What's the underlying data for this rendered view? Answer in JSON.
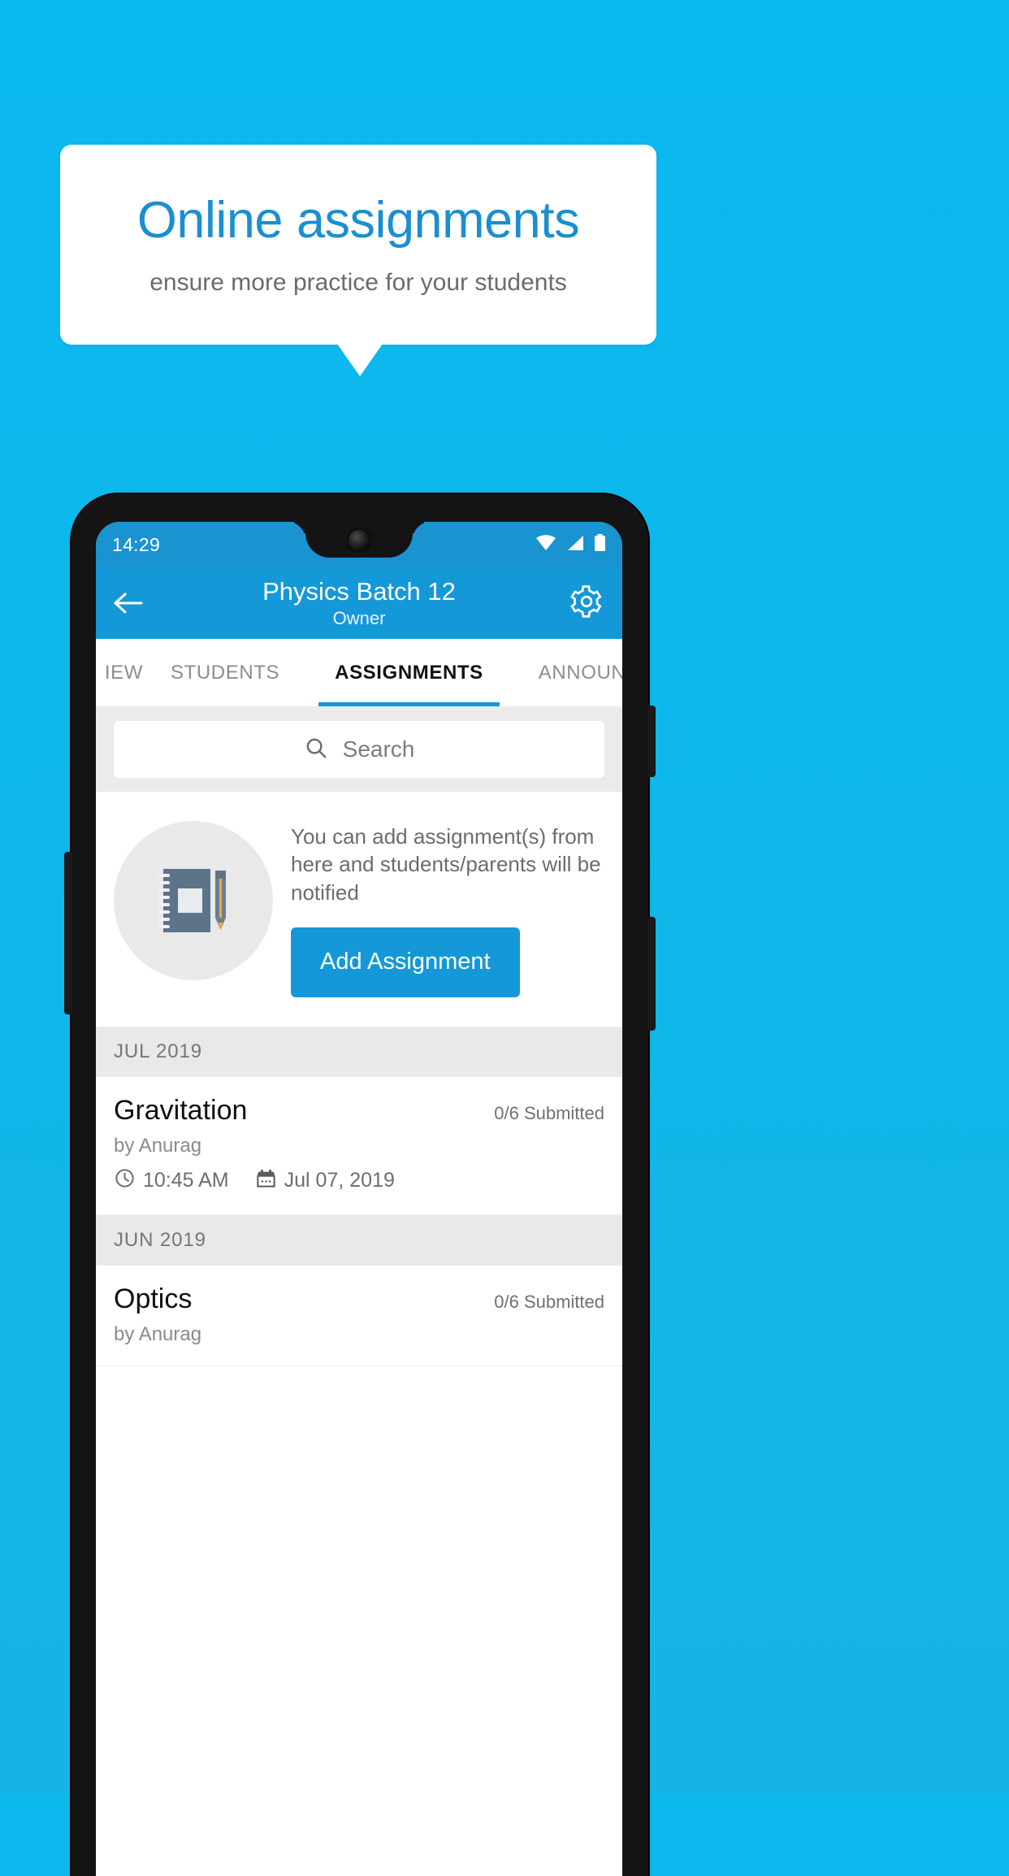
{
  "promo": {
    "background_color": "#0ab9ef",
    "callout": {
      "title": "Online assignments",
      "title_color": "#1a8fd0",
      "subtitle": "ensure more practice for your students",
      "subtitle_color": "#6b6b6b"
    }
  },
  "phone": {
    "status_bar": {
      "time": "14:29",
      "icons": [
        "wifi-icon",
        "signal-icon",
        "battery-icon"
      ],
      "background_color": "#1a93d1"
    },
    "app_bar": {
      "back_icon": "back-arrow-icon",
      "title": "Physics Batch 12",
      "subtitle": "Owner",
      "settings_icon": "gear-icon",
      "background_color": "#1598d8"
    },
    "tabs": {
      "active_index": 2,
      "indicator_color": "#1598d8",
      "items": [
        {
          "label": "IEW",
          "full_label": "OVERVIEW",
          "active": false
        },
        {
          "label": "STUDENTS",
          "active": false
        },
        {
          "label": "ASSIGNMENTS",
          "active": true
        },
        {
          "label": "ANNOUNCEMENTS",
          "active": false
        }
      ]
    },
    "search": {
      "icon": "search-icon",
      "placeholder": "Search",
      "value": ""
    },
    "empty_state": {
      "illustration": "notebook-and-pen-icon",
      "message": "You can add assignment(s) from here and students/parents will be notified",
      "button_label": "Add Assignment",
      "button_color": "#1598d8"
    },
    "sections": [
      {
        "month_label": "JUL 2019",
        "assignments": [
          {
            "title": "Gravitation",
            "submitted": "0/6 Submitted",
            "author": "by Anurag",
            "time_icon": "clock-icon",
            "time": "10:45 AM",
            "date_icon": "calendar-icon",
            "date": "Jul 07, 2019"
          }
        ]
      },
      {
        "month_label": "JUN 2019",
        "assignments": [
          {
            "title": "Optics",
            "submitted": "0/6 Submitted",
            "author": "by Anurag",
            "time_icon": "clock-icon",
            "time": "",
            "date_icon": "calendar-icon",
            "date": ""
          }
        ]
      }
    ]
  }
}
